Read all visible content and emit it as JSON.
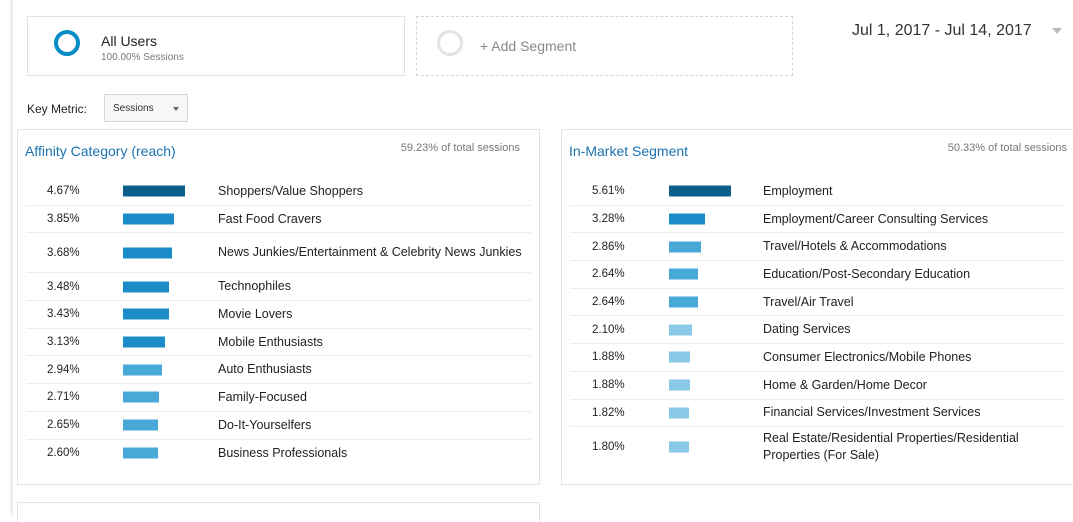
{
  "segments": {
    "all_users": {
      "name": "All Users",
      "sub": "100.00% Sessions"
    },
    "add_segment": {
      "label": "+ Add Segment"
    }
  },
  "date_range": "Jul 1, 2017 - Jul 14, 2017",
  "key_metric": {
    "label": "Key Metric:",
    "value": "Sessions"
  },
  "colors": {
    "ring_blue": "#058dc7",
    "title_blue": "#1a73b0",
    "bar_dark": "#0b5f8c",
    "bar_mid": "#1b8cc7",
    "bar_light": "#48a9d8",
    "bar_pale": "#8ac8e8"
  },
  "affinity": {
    "title": "Affinity Category (reach)",
    "share": "59.23% of total sessions",
    "rows": [
      {
        "pct": "4.67%",
        "value": 4.67,
        "category": "Shoppers/Value Shoppers"
      },
      {
        "pct": "3.85%",
        "value": 3.85,
        "category": "Fast Food Cravers"
      },
      {
        "pct": "3.68%",
        "value": 3.68,
        "category": "News Junkies/Entertainment & Celebrity News Junkies"
      },
      {
        "pct": "3.48%",
        "value": 3.48,
        "category": "Technophiles"
      },
      {
        "pct": "3.43%",
        "value": 3.43,
        "category": "Movie Lovers"
      },
      {
        "pct": "3.13%",
        "value": 3.13,
        "category": "Mobile Enthusiasts"
      },
      {
        "pct": "2.94%",
        "value": 2.94,
        "category": "Auto Enthusiasts"
      },
      {
        "pct": "2.71%",
        "value": 2.71,
        "category": "Family-Focused"
      },
      {
        "pct": "2.65%",
        "value": 2.65,
        "category": "Do-It-Yourselfers"
      },
      {
        "pct": "2.60%",
        "value": 2.6,
        "category": "Business Professionals"
      }
    ]
  },
  "inmarket": {
    "title": "In-Market Segment",
    "share": "50.33% of total sessions",
    "rows": [
      {
        "pct": "5.61%",
        "value": 5.61,
        "category": "Employment"
      },
      {
        "pct": "3.28%",
        "value": 3.28,
        "category": "Employment/Career Consulting Services"
      },
      {
        "pct": "2.86%",
        "value": 2.86,
        "category": "Travel/Hotels & Accommodations"
      },
      {
        "pct": "2.64%",
        "value": 2.64,
        "category": "Education/Post-Secondary Education"
      },
      {
        "pct": "2.64%",
        "value": 2.64,
        "category": "Travel/Air Travel"
      },
      {
        "pct": "2.10%",
        "value": 2.1,
        "category": "Dating Services"
      },
      {
        "pct": "1.88%",
        "value": 1.88,
        "category": "Consumer Electronics/Mobile Phones"
      },
      {
        "pct": "1.88%",
        "value": 1.88,
        "category": "Home & Garden/Home Decor"
      },
      {
        "pct": "1.82%",
        "value": 1.82,
        "category": "Financial Services/Investment Services"
      },
      {
        "pct": "1.80%",
        "value": 1.8,
        "category": "Real Estate/Residential Properties/Residential Properties (For Sale)"
      }
    ]
  }
}
